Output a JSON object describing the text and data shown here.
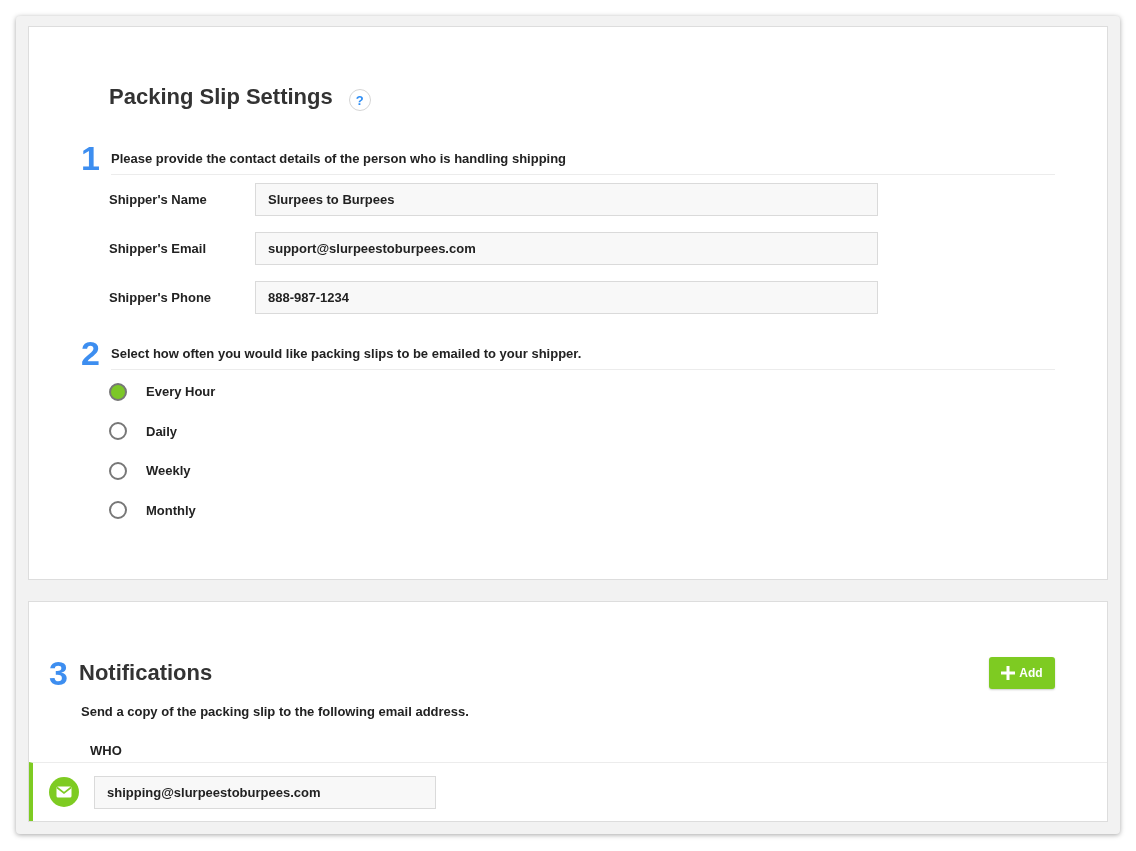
{
  "title": "Packing Slip Settings",
  "help_button": "?",
  "contact_step": {
    "number": "1",
    "instruction": "Please provide the contact details of the person who is handling shipping",
    "fields": [
      {
        "label": "Shipper's Name",
        "value": "Slurpees to Burpees"
      },
      {
        "label": "Shipper's Email",
        "value": "support@slurpeestoburpees.com"
      },
      {
        "label": "Shipper's Phone",
        "value": "888-987-1234"
      }
    ]
  },
  "frequency_step": {
    "number": "2",
    "instruction": "Select how often you would like packing slips to be emailed to your shipper.",
    "options": [
      {
        "label": "Every Hour",
        "selected": true
      },
      {
        "label": "Daily",
        "selected": false
      },
      {
        "label": "Weekly",
        "selected": false
      },
      {
        "label": "Monthly",
        "selected": false
      }
    ]
  },
  "notifications": {
    "number": "3",
    "title": "Notifications",
    "add_button": "Add",
    "description": "Send a copy of the packing slip to the following email address.",
    "column_header": "WHO",
    "recipients": [
      {
        "email": "shipping@slurpeestoburpees.com"
      }
    ]
  }
}
